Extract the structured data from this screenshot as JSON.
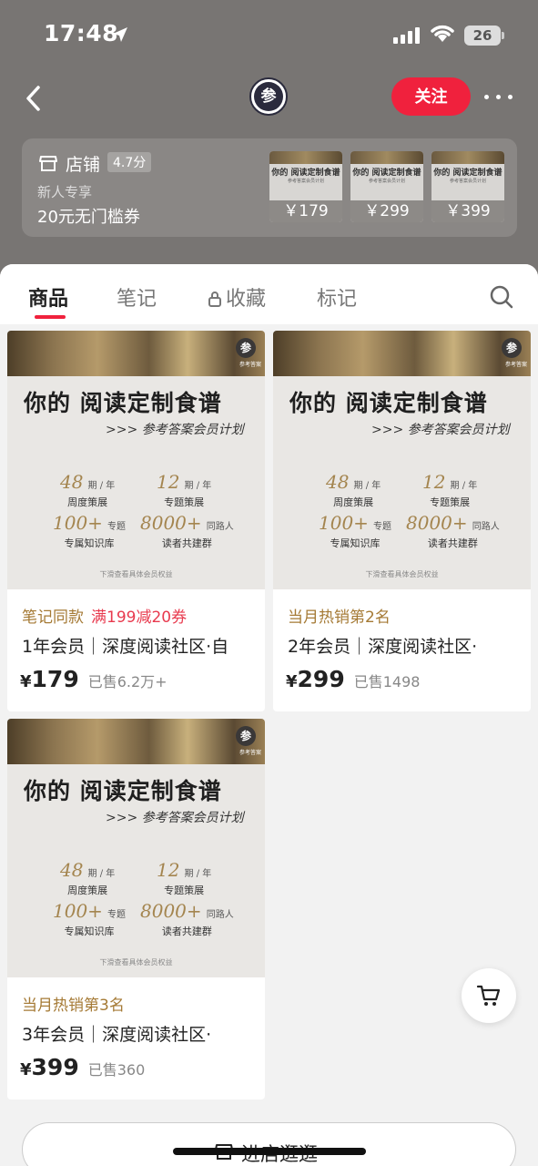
{
  "status_bar": {
    "time": "17:48",
    "battery": "26"
  },
  "header": {
    "logo_char": "参",
    "follow_label": "关注"
  },
  "shop": {
    "name": "店铺",
    "score": "4.7分",
    "new_user": "新人专享",
    "coupon": "20元无门槛券",
    "thumb_title": "你的 阅读定制食谱",
    "thumb_sub": "参考答案会员计划",
    "thumb_prices": [
      "￥179",
      "￥299",
      "￥399"
    ]
  },
  "tabs": [
    {
      "label": "商品",
      "active": true
    },
    {
      "label": "笔记",
      "active": false
    },
    {
      "label": "收藏",
      "active": false,
      "locked": true
    },
    {
      "label": "标记",
      "active": false
    }
  ],
  "poster": {
    "badge": "参",
    "badge_sub": "参考答案",
    "title": "你的 阅读定制食谱",
    "subtitle": ">>> 参考答案会员计划",
    "stats": [
      {
        "num": "48",
        "unit": "期 / 年",
        "label": "周度策展"
      },
      {
        "num": "12",
        "unit": "期 / 年",
        "label": "专题策展"
      },
      {
        "num": "100+",
        "unit": "专题",
        "label": "专属知识库"
      },
      {
        "num": "8000+",
        "unit": "同路人",
        "label": "读者共建群"
      }
    ],
    "hint": "下滑查看具体会员权益"
  },
  "products": [
    {
      "tag": "笔记同款",
      "promo": "满199减20券",
      "title": "1年会员｜深度阅读社区·自",
      "currency": "¥",
      "price": "179",
      "sold": "已售6.2万+"
    },
    {
      "tag": "当月热销第2名",
      "promo": "",
      "title": "2年会员｜深度阅读社区·",
      "currency": "¥",
      "price": "299",
      "sold": "已售1498"
    },
    {
      "tag": "当月热销第3名",
      "promo": "",
      "title": "3年会员｜深度阅读社区·",
      "currency": "¥",
      "price": "399",
      "sold": "已售360"
    }
  ],
  "footer": {
    "enter_label": "进店逛逛"
  },
  "colors": {
    "accent": "#f0213d",
    "tag_gold": "#a57a35",
    "promo_red": "#e83a4e"
  }
}
